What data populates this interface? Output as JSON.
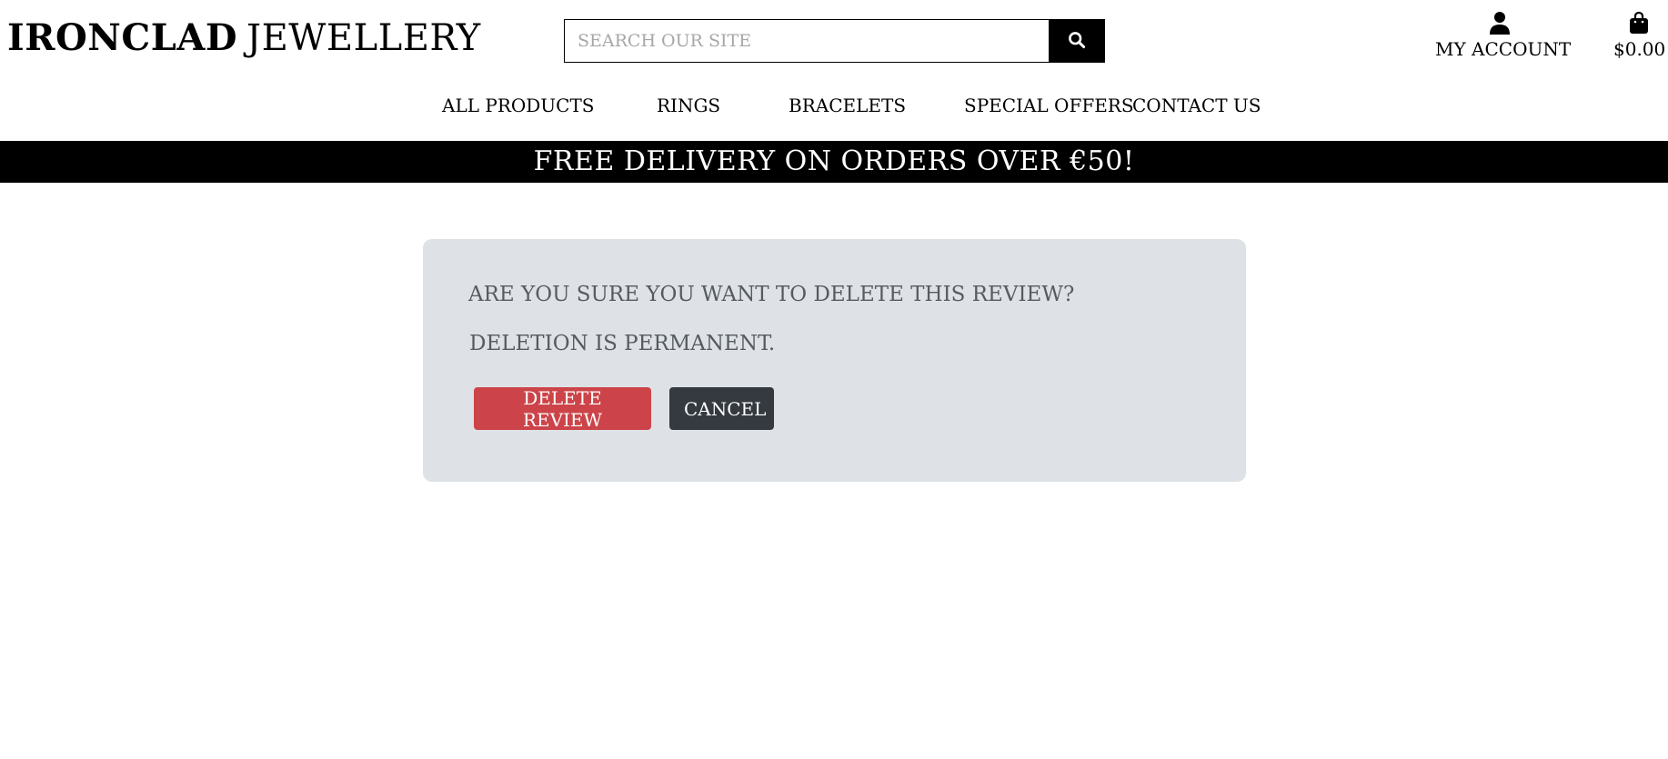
{
  "brand": {
    "name_strong": "IRONCLAD",
    "name_light": "JEWELLERY"
  },
  "search": {
    "placeholder": "SEARCH OUR SITE",
    "value": "",
    "button_icon": "search-icon"
  },
  "account": {
    "icon": "user-icon",
    "label": "MY ACCOUNT"
  },
  "bag": {
    "icon": "shopping-bag-icon",
    "total": "$0.00"
  },
  "nav": {
    "items": [
      {
        "label": "ALL PRODUCTS"
      },
      {
        "label": "RINGS"
      },
      {
        "label": "BRACELETS"
      },
      {
        "label": "SPECIAL OFFERS"
      },
      {
        "label": "CONTACT US"
      }
    ]
  },
  "banner": {
    "text": "FREE DELIVERY ON ORDERS OVER €50!"
  },
  "confirm": {
    "question": "ARE YOU SURE YOU WANT TO DELETE THIS REVIEW?",
    "note": "DELETION IS PERMANENT.",
    "delete_label": "DELETE REVIEW",
    "cancel_label": "CANCEL"
  },
  "colors": {
    "banner_bg": "#000000",
    "panel_bg": "#dee2e6",
    "delete_btn": "#cc4449",
    "cancel_btn": "#343a40"
  }
}
